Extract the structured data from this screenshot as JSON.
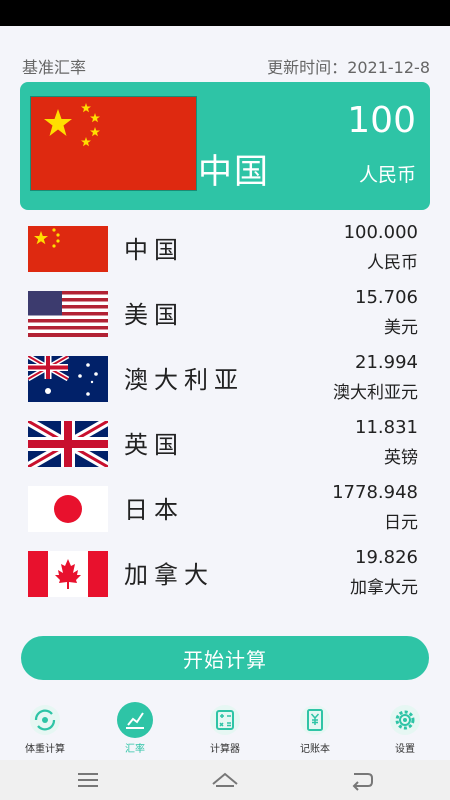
{
  "header": {
    "title": "基准汇率",
    "update_label": "更新时间：",
    "update_date": "2021-12-8"
  },
  "base": {
    "country": "中国",
    "amount": "100",
    "unit": "人民币",
    "flag_icon": "china-flag"
  },
  "rates": [
    {
      "country": "中国",
      "value": "100.000",
      "unit": "人民币",
      "flag_icon": "china-flag"
    },
    {
      "country": "美国",
      "value": "15.706",
      "unit": "美元",
      "flag_icon": "usa-flag"
    },
    {
      "country": "澳大利亚",
      "value": "21.994",
      "unit": "澳大利亚元",
      "flag_icon": "australia-flag"
    },
    {
      "country": "英国",
      "value": "11.831",
      "unit": "英镑",
      "flag_icon": "uk-flag"
    },
    {
      "country": "日本",
      "value": "1778.948",
      "unit": "日元",
      "flag_icon": "japan-flag"
    },
    {
      "country": "加拿大",
      "value": "19.826",
      "unit": "加拿大元",
      "flag_icon": "canada-flag"
    }
  ],
  "action": {
    "start_label": "开始计算"
  },
  "tabs": [
    {
      "label": "体重计算",
      "icon": "weight-icon"
    },
    {
      "label": "汇率",
      "icon": "exchange-chart-icon",
      "active": true
    },
    {
      "label": "计算器",
      "icon": "calculator-icon"
    },
    {
      "label": "记账本",
      "icon": "ledger-icon"
    },
    {
      "label": "设置",
      "icon": "settings-gear-icon"
    }
  ],
  "colors": {
    "accent": "#2ec4a6",
    "background": "#f4f5fa"
  }
}
